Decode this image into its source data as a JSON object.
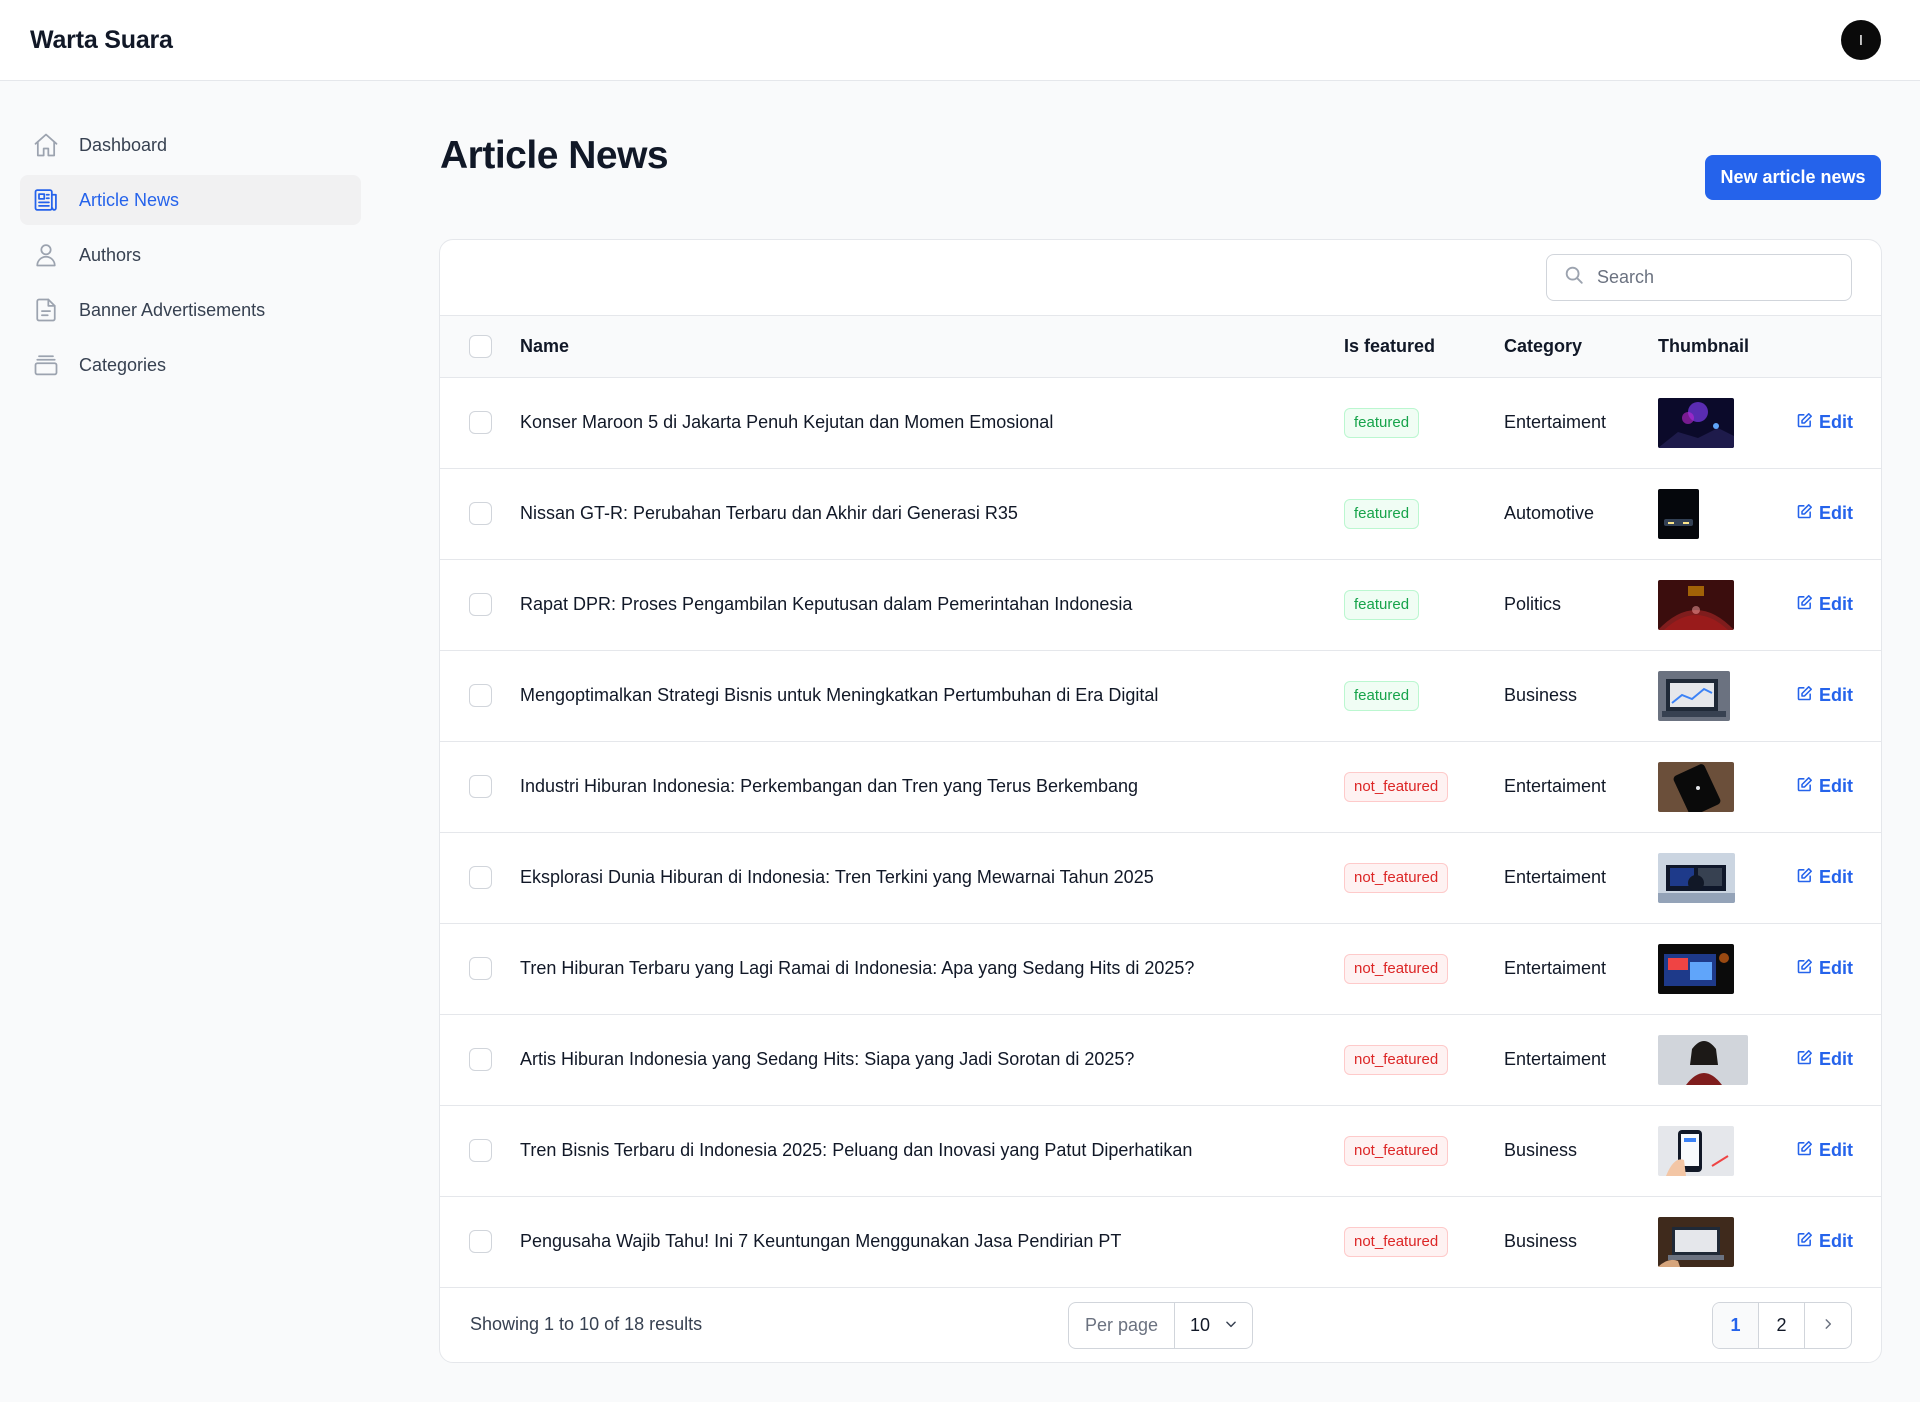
{
  "app": {
    "brand": "Warta Suara",
    "avatar_initial": "I"
  },
  "sidebar": {
    "items": [
      {
        "label": "Dashboard",
        "icon": "home-icon",
        "active": false
      },
      {
        "label": "Article News",
        "icon": "newspaper-icon",
        "active": true
      },
      {
        "label": "Authors",
        "icon": "user-icon",
        "active": false
      },
      {
        "label": "Banner Advertisements",
        "icon": "document-icon",
        "active": false
      },
      {
        "label": "Categories",
        "icon": "archive-box-icon",
        "active": false
      }
    ]
  },
  "page": {
    "title": "Article News",
    "new_button": "New article news"
  },
  "search": {
    "placeholder": "Search"
  },
  "table": {
    "headers": {
      "name": "Name",
      "featured": "Is featured",
      "category": "Category",
      "thumbnail": "Thumbnail"
    },
    "edit_label": "Edit",
    "rows": [
      {
        "name": "Konser Maroon 5 di Jakarta Penuh Kejutan dan Momen Emosional",
        "featured": "featured",
        "category": "Entertaiment",
        "thumb": "concert crowd purple lights"
      },
      {
        "name": "Nissan GT-R: Perubahan Terbaru dan Akhir dari Generasi R35",
        "featured": "featured",
        "category": "Automotive",
        "thumb": "dark car at night"
      },
      {
        "name": "Rapat DPR: Proses Pengambilan Keputusan dalam Pemerintahan Indonesia",
        "featured": "featured",
        "category": "Politics",
        "thumb": "parliament hall red seats"
      },
      {
        "name": "Mengoptimalkan Strategi Bisnis untuk Meningkatkan Pertumbuhan di Era Digital",
        "featured": "featured",
        "category": "Business",
        "thumb": "laptop with charts"
      },
      {
        "name": "Industri Hiburan Indonesia: Perkembangan dan Tren yang Terus Berkembang",
        "featured": "not_featured",
        "category": "Entertaiment",
        "thumb": "phone on wooden table"
      },
      {
        "name": "Eksplorasi Dunia Hiburan di Indonesia: Tren Terkini yang Mewarnai Tahun 2025",
        "featured": "not_featured",
        "category": "Entertaiment",
        "thumb": "gaming desk monitors"
      },
      {
        "name": "Tren Hiburan Terbaru yang Lagi Ramai di Indonesia: Apa yang Sedang Hits di 2025?",
        "featured": "not_featured",
        "category": "Entertaiment",
        "thumb": "tv screen dark room"
      },
      {
        "name": "Artis Hiburan Indonesia yang Sedang Hits: Siapa yang Jadi Sorotan di 2025?",
        "featured": "not_featured",
        "category": "Entertaiment",
        "thumb": "woman portrait"
      },
      {
        "name": "Tren Bisnis Terbaru di Indonesia 2025: Peluang dan Inovasi yang Patut Diperhatikan",
        "featured": "not_featured",
        "category": "Business",
        "thumb": "hand holding phone"
      },
      {
        "name": "Pengusaha Wajib Tahu! Ini 7 Keuntungan Menggunakan Jasa Pendirian PT",
        "featured": "not_featured",
        "category": "Business",
        "thumb": "laptop on desk"
      }
    ]
  },
  "footer": {
    "results": "Showing 1 to 10 of 18 results",
    "per_page_label": "Per page",
    "per_page_value": "10",
    "pages": [
      "1",
      "2"
    ],
    "current_page": "1"
  },
  "colors": {
    "accent": "#2563eb",
    "featured": "#16a34a",
    "not_featured": "#dc2626"
  }
}
